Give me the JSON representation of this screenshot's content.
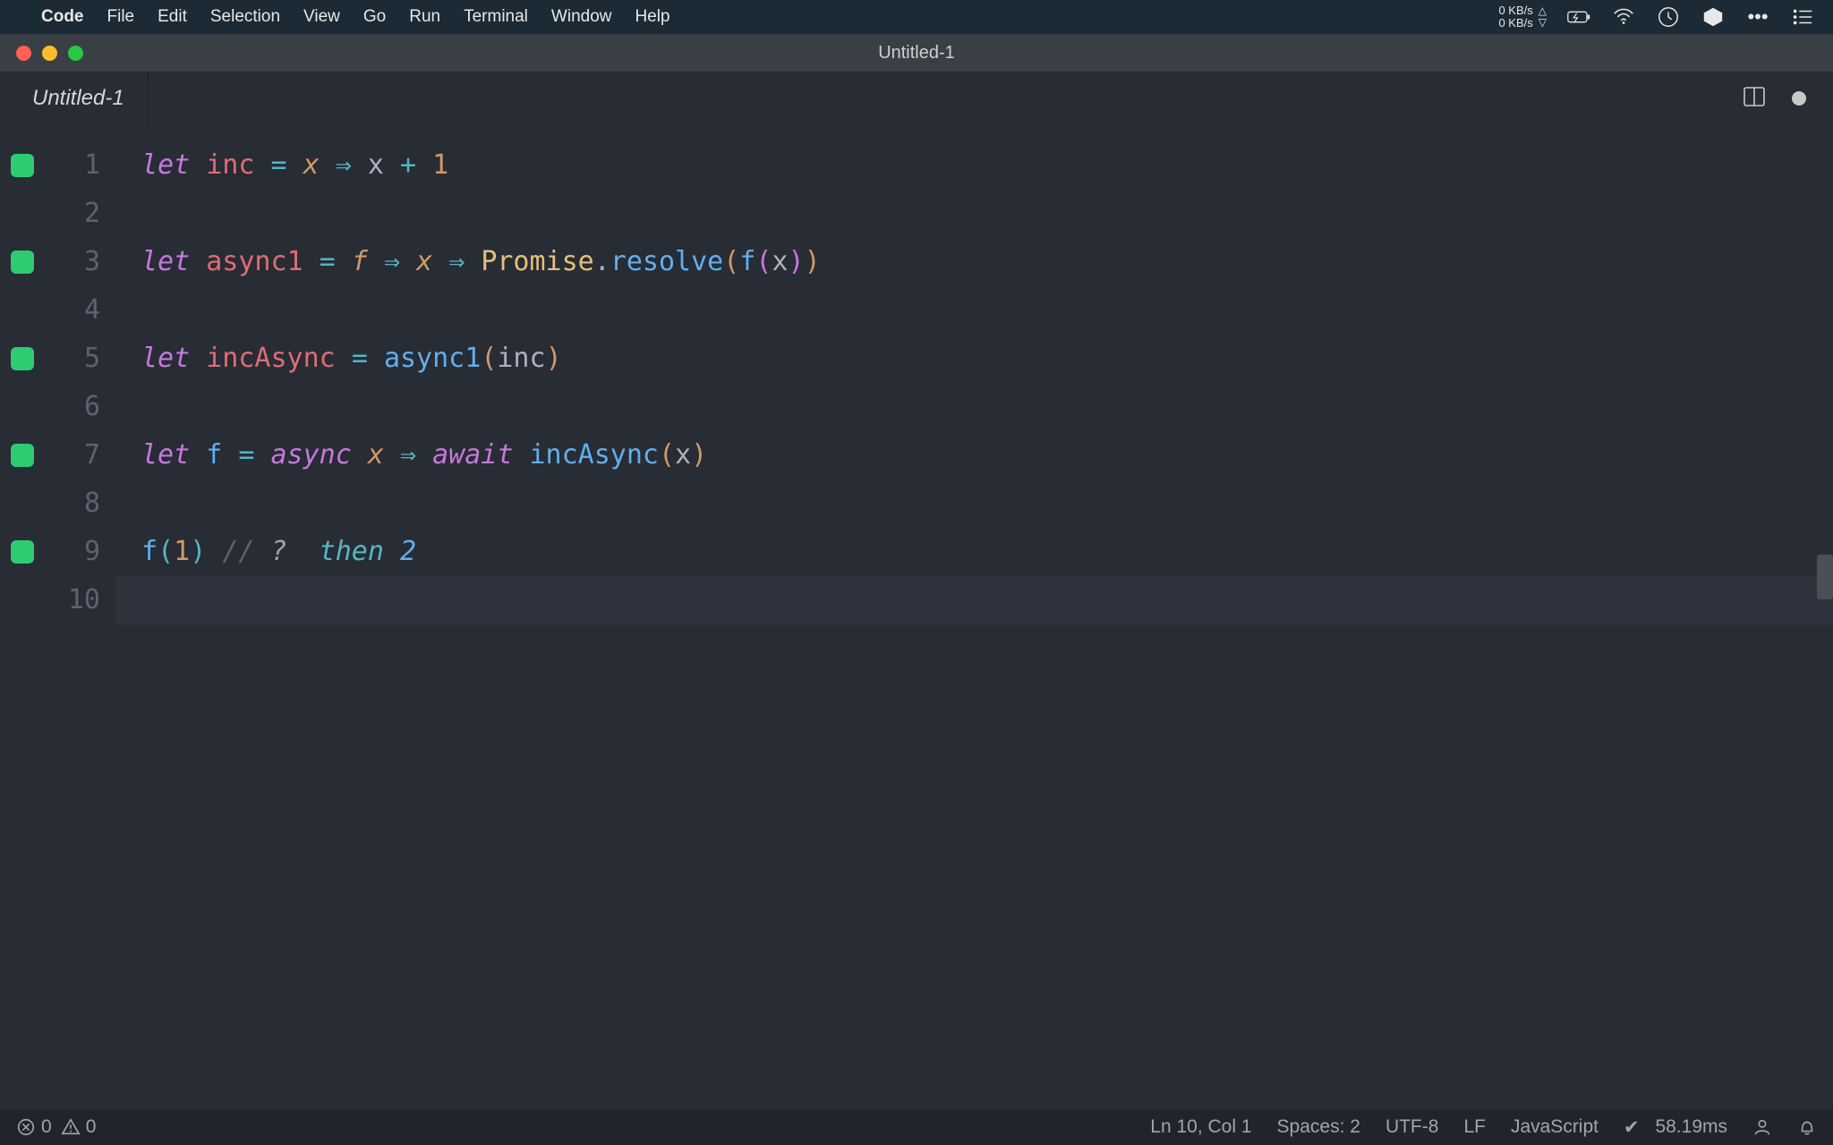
{
  "menubar": {
    "app": "Code",
    "items": [
      "File",
      "Edit",
      "Selection",
      "View",
      "Go",
      "Run",
      "Terminal",
      "Window",
      "Help"
    ],
    "net_up": "0 KB/s",
    "net_down": "0 KB/s"
  },
  "window": {
    "title": "Untitled-1"
  },
  "tabs": {
    "active": "Untitled-1"
  },
  "editor": {
    "marked_lines": [
      1,
      3,
      5,
      7,
      9
    ],
    "code_lines": [
      {
        "n": 1,
        "tokens": [
          [
            "kw",
            "let"
          ],
          [
            "sp",
            " "
          ],
          [
            "ident",
            "inc"
          ],
          [
            "sp",
            " "
          ],
          [
            "op",
            "="
          ],
          [
            "sp",
            " "
          ],
          [
            "param",
            "x"
          ],
          [
            "sp",
            " "
          ],
          [
            "op",
            "⇒"
          ],
          [
            "sp",
            " "
          ],
          [
            "ident2",
            "x"
          ],
          [
            "sp",
            " "
          ],
          [
            "op",
            "+"
          ],
          [
            "sp",
            " "
          ],
          [
            "num",
            "1"
          ]
        ]
      },
      {
        "n": 2,
        "tokens": []
      },
      {
        "n": 3,
        "tokens": [
          [
            "kw",
            "let"
          ],
          [
            "sp",
            " "
          ],
          [
            "ident",
            "async1"
          ],
          [
            "sp",
            " "
          ],
          [
            "op",
            "="
          ],
          [
            "sp",
            " "
          ],
          [
            "param",
            "f"
          ],
          [
            "sp",
            " "
          ],
          [
            "op",
            "⇒"
          ],
          [
            "sp",
            " "
          ],
          [
            "param",
            "x"
          ],
          [
            "sp",
            " "
          ],
          [
            "op",
            "⇒"
          ],
          [
            "sp",
            " "
          ],
          [
            "class",
            "Promise"
          ],
          [
            "punct",
            "."
          ],
          [
            "func",
            "resolve"
          ],
          [
            "paren",
            "("
          ],
          [
            "func",
            "f"
          ],
          [
            "paren2",
            "("
          ],
          [
            "ident2",
            "x"
          ],
          [
            "paren2",
            ")"
          ],
          [
            "paren",
            ")"
          ]
        ]
      },
      {
        "n": 4,
        "tokens": []
      },
      {
        "n": 5,
        "tokens": [
          [
            "kw",
            "let"
          ],
          [
            "sp",
            " "
          ],
          [
            "ident",
            "incAsync"
          ],
          [
            "sp",
            " "
          ],
          [
            "op",
            "="
          ],
          [
            "sp",
            " "
          ],
          [
            "func",
            "async1"
          ],
          [
            "paren",
            "("
          ],
          [
            "ident2",
            "inc"
          ],
          [
            "paren",
            ")"
          ]
        ]
      },
      {
        "n": 6,
        "tokens": []
      },
      {
        "n": 7,
        "tokens": [
          [
            "kw",
            "let"
          ],
          [
            "sp",
            " "
          ],
          [
            "func",
            "f"
          ],
          [
            "sp",
            " "
          ],
          [
            "op",
            "="
          ],
          [
            "sp",
            " "
          ],
          [
            "kw2",
            "async"
          ],
          [
            "sp",
            " "
          ],
          [
            "param",
            "x"
          ],
          [
            "sp",
            " "
          ],
          [
            "op",
            "⇒"
          ],
          [
            "sp",
            " "
          ],
          [
            "kw2",
            "await"
          ],
          [
            "sp",
            " "
          ],
          [
            "func",
            "incAsync"
          ],
          [
            "paren",
            "("
          ],
          [
            "ident2",
            "x"
          ],
          [
            "paren",
            ")"
          ]
        ]
      },
      {
        "n": 8,
        "tokens": []
      },
      {
        "n": 9,
        "tokens": [
          [
            "func",
            "f"
          ],
          [
            "paren3",
            "("
          ],
          [
            "num",
            "1"
          ],
          [
            "paren3",
            ")"
          ],
          [
            "sp",
            " "
          ],
          [
            "comment",
            "//"
          ],
          [
            "sp",
            " "
          ],
          [
            "quokka",
            "? "
          ],
          [
            "sp",
            " "
          ],
          [
            "quokka-then",
            "then"
          ],
          [
            "sp",
            " "
          ],
          [
            "quokka-num",
            "2"
          ]
        ]
      },
      {
        "n": 10,
        "tokens": [],
        "current": true
      }
    ]
  },
  "statusbar": {
    "errors": "0",
    "warnings": "0",
    "ln_col": "Ln 10, Col 1",
    "spaces": "Spaces: 2",
    "encoding": "UTF-8",
    "eol": "LF",
    "language": "JavaScript",
    "timing": "58.19ms"
  }
}
